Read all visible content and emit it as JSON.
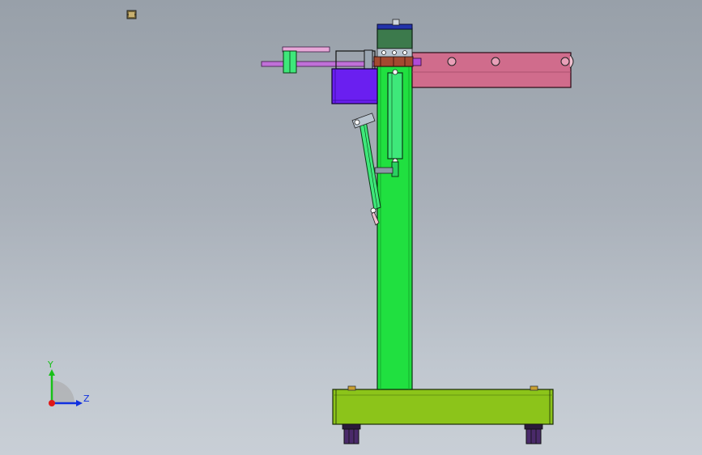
{
  "view": {
    "triad": {
      "y_label": "Y",
      "z_label": "Z",
      "y_color": "#18c018",
      "z_color": "#1030e0",
      "x_color": "#e01818"
    }
  },
  "model": {
    "colors": {
      "column": "#20e040",
      "base_plate": "#8cc41a",
      "arm": "#d06c8c",
      "motor_block": "#6a1ff0",
      "cylinder": "#3ee87a",
      "top_housing": "#3c7a4c",
      "top_cap": "#2233aa",
      "feet": "#4a2a6a",
      "rod": "#c070d8"
    }
  }
}
